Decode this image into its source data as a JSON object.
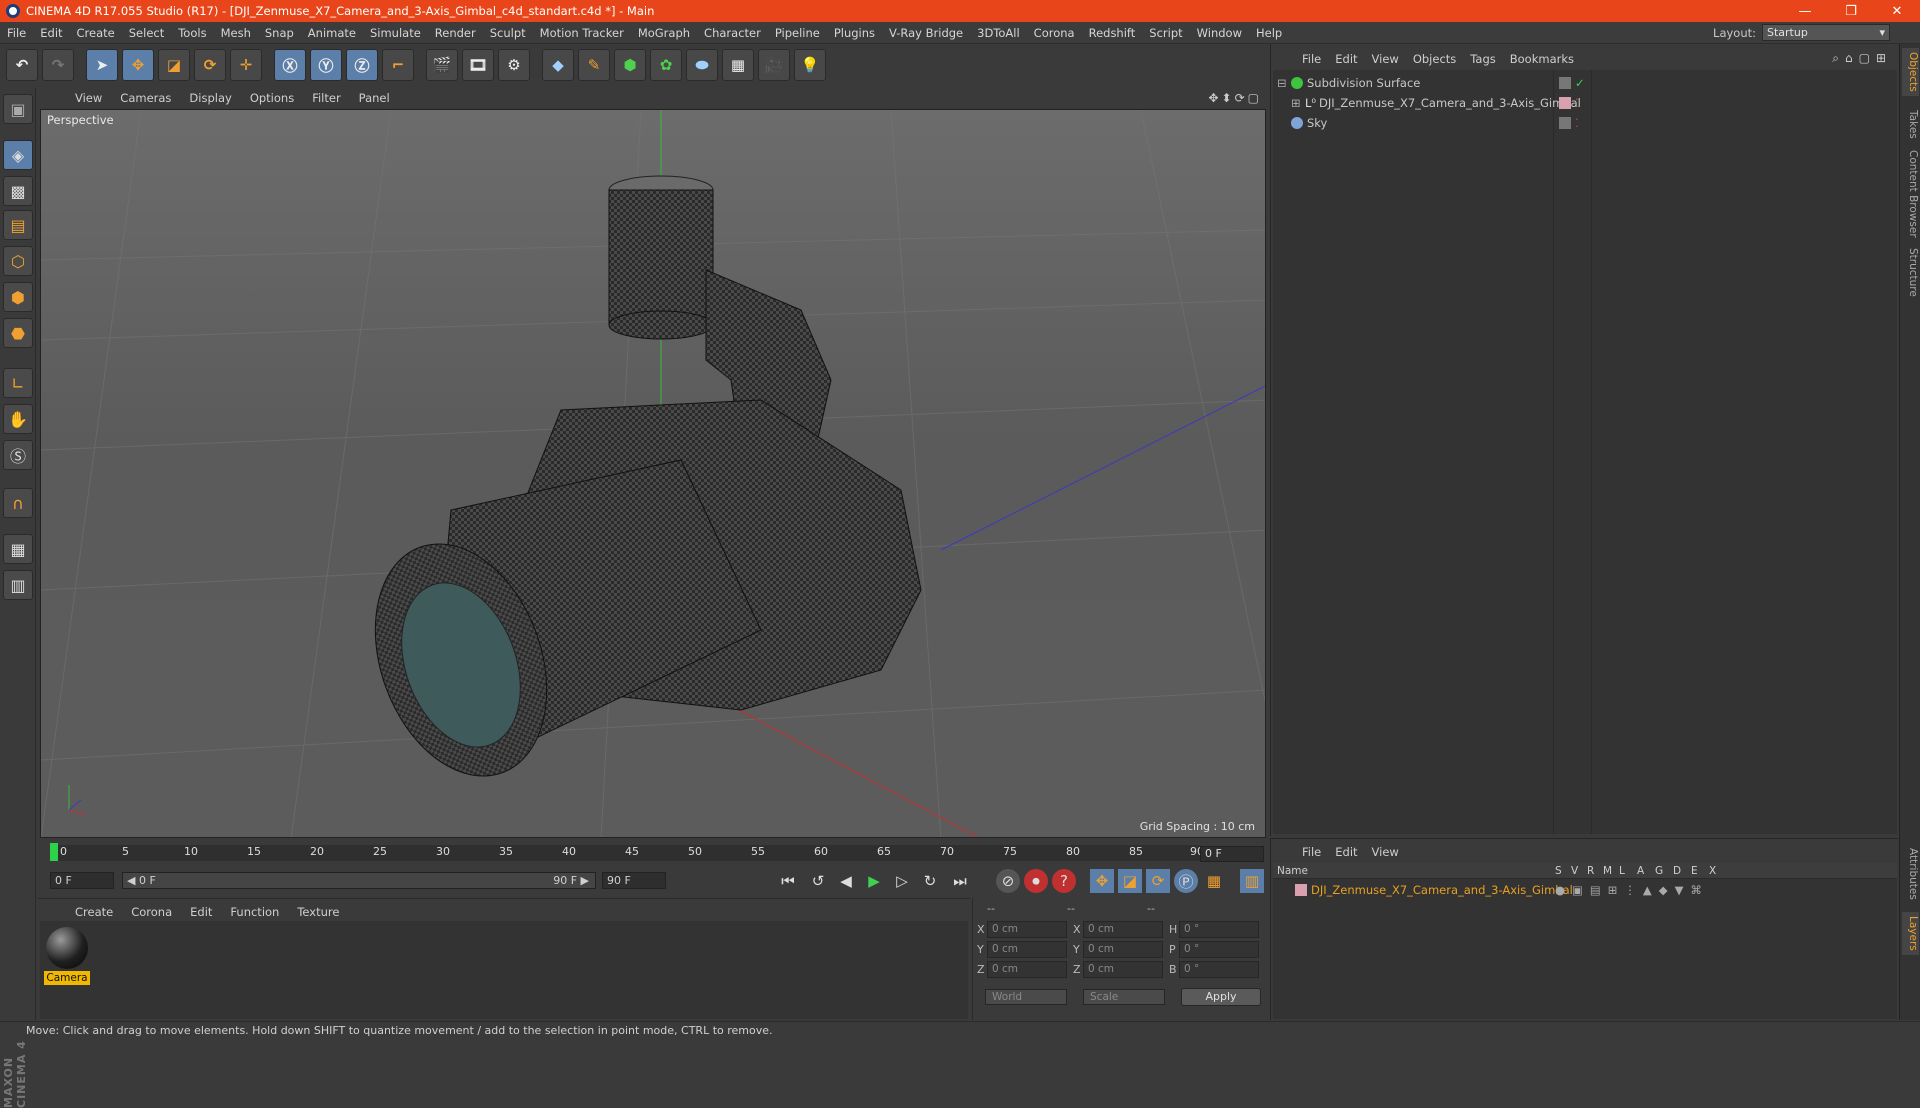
{
  "window": {
    "title": "CINEMA 4D R17.055 Studio (R17) - [DJI_Zenmuse_X7_Camera_and_3-Axis_Gimbal_c4d_standart.c4d *] - Main",
    "minimize": "—",
    "restore": "❐",
    "close": "✕"
  },
  "menubar": [
    "File",
    "Edit",
    "Create",
    "Select",
    "Tools",
    "Mesh",
    "Snap",
    "Animate",
    "Simulate",
    "Render",
    "Sculpt",
    "Motion Tracker",
    "MoGraph",
    "Character",
    "Pipeline",
    "Plugins",
    "V-Ray Bridge",
    "3DToAll",
    "Corona",
    "Redshift",
    "Script",
    "Window",
    "Help"
  ],
  "layout": {
    "label": "Layout:",
    "value": "Startup"
  },
  "viewport": {
    "menu": [
      "View",
      "Cameras",
      "Display",
      "Options",
      "Filter",
      "Panel"
    ],
    "label": "Perspective",
    "grid_spacing": "Grid Spacing : 10 cm"
  },
  "timeline": {
    "ticks": [
      "0",
      "5",
      "10",
      "15",
      "20",
      "25",
      "30",
      "35",
      "40",
      "45",
      "50",
      "55",
      "60",
      "65",
      "70",
      "75",
      "80",
      "85",
      "90"
    ],
    "current_frame": "0 F",
    "start": "0 F",
    "range_start": "◀ 0 F",
    "range_end": "90 F ▶",
    "end": "90 F"
  },
  "materials": {
    "menu": [
      "Create",
      "Corona",
      "Edit",
      "Function",
      "Texture"
    ],
    "items": [
      {
        "name": "Camera"
      }
    ]
  },
  "coords": {
    "header": [
      "--",
      "--",
      "--"
    ],
    "rows": [
      {
        "a": "X",
        "av": "0 cm",
        "b": "X",
        "bv": "0 cm",
        "c": "H",
        "cv": "0 °"
      },
      {
        "a": "Y",
        "av": "0 cm",
        "b": "Y",
        "bv": "0 cm",
        "c": "P",
        "cv": "0 °"
      },
      {
        "a": "Z",
        "av": "0 cm",
        "b": "Z",
        "bv": "0 cm",
        "c": "B",
        "cv": "0 °"
      }
    ],
    "mode1": "World",
    "mode2": "Scale",
    "apply": "Apply"
  },
  "objects": {
    "menu": [
      "File",
      "Edit",
      "View",
      "Objects",
      "Tags",
      "Bookmarks"
    ],
    "items": [
      {
        "name": "Subdivision Surface",
        "color": "#3fc43f"
      },
      {
        "name": "DJI_Zenmuse_X7_Camera_and_3-Axis_Gimbal",
        "color": "#9fb3d9"
      },
      {
        "name": "Sky",
        "color": "#7fa4d8"
      }
    ]
  },
  "layers": {
    "menu": [
      "File",
      "Edit",
      "View"
    ],
    "columns": [
      "Name",
      "S",
      "V",
      "R",
      "M",
      "L",
      "A",
      "G",
      "D",
      "E",
      "X"
    ],
    "items": [
      {
        "name": "DJI_Zenmuse_X7_Camera_and_3-Axis_Gimbal",
        "color": "#e8a020"
      }
    ]
  },
  "sidetabs": [
    "Objects",
    "Takes",
    "Content Browser",
    "Structure",
    "Attributes",
    "Layers"
  ],
  "status": "Move: Click and drag to move elements. Hold down SHIFT to quantize movement / add to the selection in point mode, CTRL to remove.",
  "brand": "MAXON CINEMA 4D"
}
